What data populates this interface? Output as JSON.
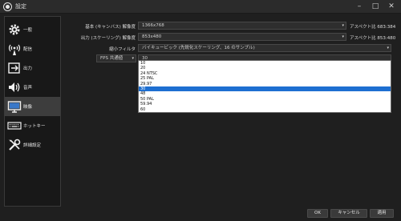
{
  "window": {
    "title": "設定"
  },
  "sidebar": {
    "items": [
      {
        "label": "一般",
        "icon": "gear-icon"
      },
      {
        "label": "配信",
        "icon": "broadcast-icon"
      },
      {
        "label": "出力",
        "icon": "output-icon"
      },
      {
        "label": "音声",
        "icon": "speaker-icon"
      },
      {
        "label": "映像",
        "icon": "monitor-icon",
        "active": true
      },
      {
        "label": "ホットキー",
        "icon": "keyboard-icon"
      },
      {
        "label": "詳細設定",
        "icon": "tools-icon"
      }
    ]
  },
  "video": {
    "base_label": "基本 (キャンバス) 解像度",
    "base_value": "1366x768",
    "base_aspect": "アスペクト比 683:384",
    "output_label": "出力 (スケーリング) 解像度",
    "output_value": "853x480",
    "output_aspect": "アスペクト比 853:480",
    "filter_label": "縮小フィルタ",
    "filter_value": "バイキュービック (先鋭化スケーリング、16 のサンプル)",
    "fps_type_value": "FPS 共通値",
    "fps_value": "30",
    "fps_options": [
      "10",
      "20",
      "24 NTSC",
      "25 PAL",
      "29.97",
      "30",
      "48",
      "50 PAL",
      "59.94",
      "60"
    ],
    "fps_selected_index": 5
  },
  "buttons": {
    "ok": "OK",
    "cancel": "キャンセル",
    "apply": "適用"
  },
  "colors": {
    "selected": "#1e6fd1",
    "background": "#1f1f1f",
    "active_nav": "#3d3d3d"
  }
}
